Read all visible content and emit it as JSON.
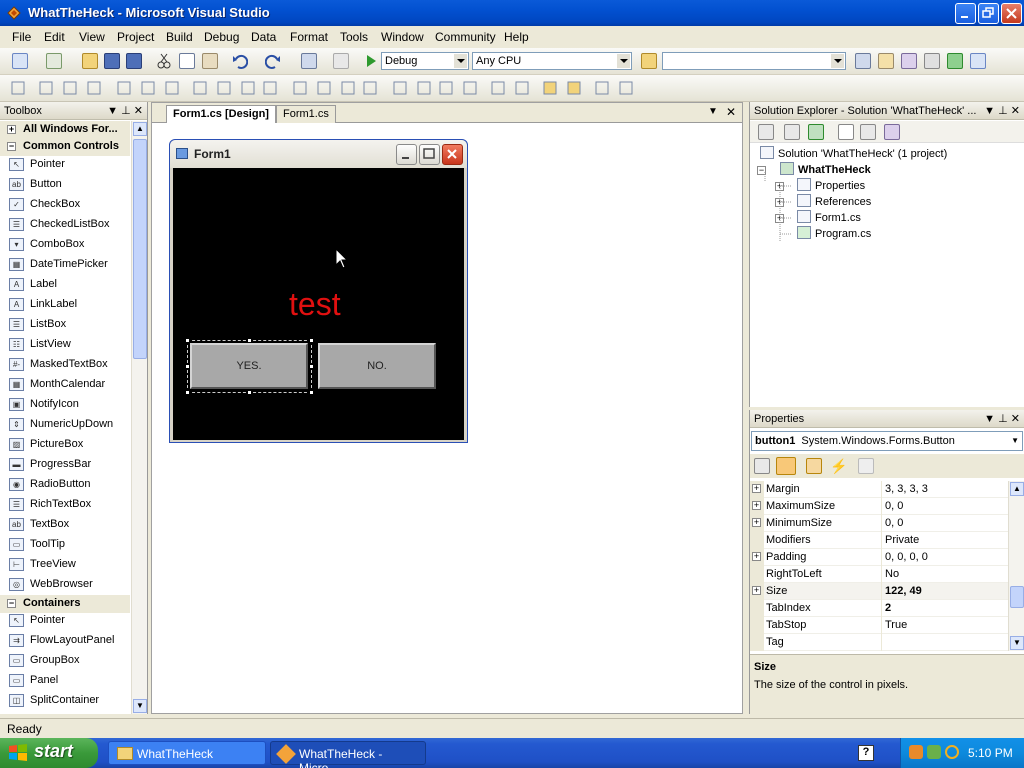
{
  "window": {
    "title": "WhatTheHeck - Microsoft Visual Studio"
  },
  "menu": [
    "File",
    "Edit",
    "View",
    "Project",
    "Build",
    "Debug",
    "Data",
    "Format",
    "Tools",
    "Window",
    "Community",
    "Help"
  ],
  "toolbar": {
    "config": "Debug",
    "platform": "Any CPU",
    "find": ""
  },
  "toolbox": {
    "title": "Toolbox",
    "categories": [
      {
        "label": "All Windows For...",
        "expanded": false
      },
      {
        "label": "Common Controls",
        "expanded": true
      },
      {
        "label": "Containers",
        "expanded": true
      }
    ],
    "common_items": [
      "Pointer",
      "Button",
      "CheckBox",
      "CheckedListBox",
      "ComboBox",
      "DateTimePicker",
      "Label",
      "LinkLabel",
      "ListBox",
      "ListView",
      "MaskedTextBox",
      "MonthCalendar",
      "NotifyIcon",
      "NumericUpDown",
      "PictureBox",
      "ProgressBar",
      "RadioButton",
      "RichTextBox",
      "TextBox",
      "ToolTip",
      "TreeView",
      "WebBrowser"
    ],
    "common_icons": [
      "pointer-icon",
      "button-icon",
      "checkbox-icon",
      "checkedlistbox-icon",
      "combobox-icon",
      "datetimepicker-icon",
      "label-icon",
      "linklabel-icon",
      "listbox-icon",
      "listview-icon",
      "maskedtextbox-icon",
      "monthcalendar-icon",
      "notifyicon-icon",
      "numericupdown-icon",
      "picturebox-icon",
      "progressbar-icon",
      "radiobutton-icon",
      "richtextbox-icon",
      "textbox-icon",
      "tooltip-icon",
      "treeview-icon",
      "webbrowser-icon"
    ],
    "container_items": [
      "Pointer",
      "FlowLayoutPanel",
      "GroupBox",
      "Panel",
      "SplitContainer"
    ]
  },
  "designer": {
    "tabs": [
      "Form1.cs [Design]",
      "Form1.cs"
    ],
    "form_title": "Form1",
    "label_text": "test",
    "label_color": "#e01010",
    "buttons": [
      "YES.",
      "NO."
    ]
  },
  "solution_explorer": {
    "title": "Solution Explorer - Solution 'WhatTheHeck' ...",
    "solution": "Solution 'WhatTheHeck' (1 project)",
    "project": "WhatTheHeck",
    "items": [
      "Properties",
      "References",
      "Form1.cs",
      "Program.cs"
    ]
  },
  "properties": {
    "title": "Properties",
    "object_name": "button1",
    "object_type": "System.Windows.Forms.Button",
    "rows": [
      {
        "name": "Margin",
        "value": "3, 3, 3, 3",
        "expandable": true,
        "bold": false
      },
      {
        "name": "MaximumSize",
        "value": "0, 0",
        "expandable": true,
        "bold": false
      },
      {
        "name": "MinimumSize",
        "value": "0, 0",
        "expandable": true,
        "bold": false
      },
      {
        "name": "Modifiers",
        "value": "Private",
        "expandable": false,
        "bold": false
      },
      {
        "name": "Padding",
        "value": "0, 0, 0, 0",
        "expandable": true,
        "bold": false
      },
      {
        "name": "RightToLeft",
        "value": "No",
        "expandable": false,
        "bold": false
      },
      {
        "name": "Size",
        "value": "122, 49",
        "expandable": true,
        "bold": true
      },
      {
        "name": "TabIndex",
        "value": "2",
        "expandable": false,
        "bold": true
      },
      {
        "name": "TabStop",
        "value": "True",
        "expandable": false,
        "bold": false
      },
      {
        "name": "Tag",
        "value": "",
        "expandable": false,
        "bold": false
      }
    ],
    "desc_title": "Size",
    "desc_text": "The size of the control in pixels."
  },
  "status": {
    "text": "Ready"
  },
  "taskbar": {
    "start": "start",
    "tasks": [
      "WhatTheHeck",
      "WhatTheHeck - Micro..."
    ],
    "clock": "5:10 PM"
  }
}
